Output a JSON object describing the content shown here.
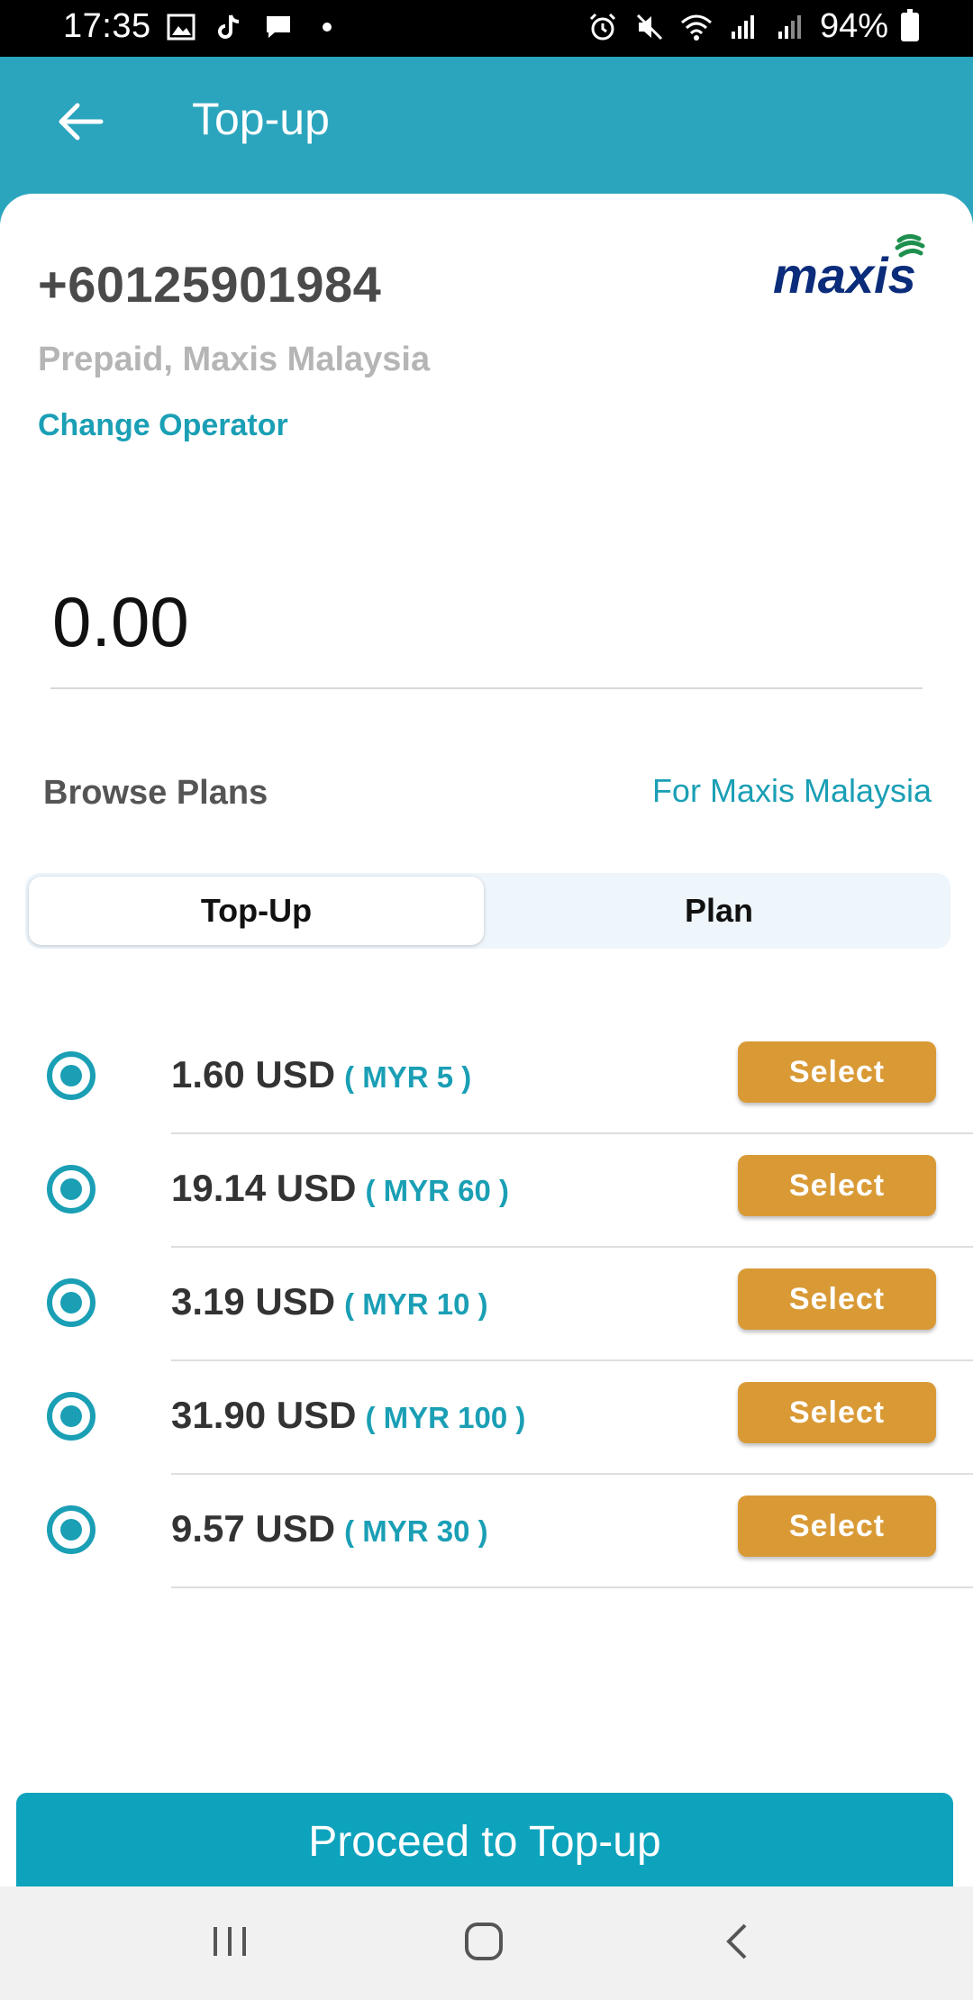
{
  "status_bar": {
    "time": "17:35",
    "battery": "94%",
    "left_icons": [
      "gallery-icon",
      "tiktok-icon",
      "message-icon",
      "dot-icon"
    ],
    "right_icons": [
      "alarm-icon",
      "mute-icon",
      "wifi-icon",
      "signal-icon",
      "signal-icon"
    ]
  },
  "app_bar": {
    "title": "Top-up",
    "back_icon": "arrow-left-icon"
  },
  "account": {
    "phone": "+60125901984",
    "operator_desc": "Prepaid, Maxis Malaysia",
    "change_operator": "Change Operator",
    "logo_text": "maxis"
  },
  "amount": {
    "value": "0.00"
  },
  "plans": {
    "browse_label": "Browse Plans",
    "for_operator": "For Maxis Malaysia",
    "tabs": [
      {
        "label": "Top-Up",
        "active": true
      },
      {
        "label": "Plan",
        "active": false
      }
    ],
    "items": [
      {
        "price": "1.60 USD",
        "local": "( MYR 5 )",
        "button": "Select"
      },
      {
        "price": "19.14 USD",
        "local": "( MYR 60 )",
        "button": "Select"
      },
      {
        "price": "3.19 USD",
        "local": "( MYR 10 )",
        "button": "Select"
      },
      {
        "price": "31.90 USD",
        "local": "( MYR 100 )",
        "button": "Select"
      },
      {
        "price": "9.57 USD",
        "local": "( MYR 30 )",
        "button": "Select"
      }
    ]
  },
  "proceed_label": "Proceed to Top-up",
  "nav": [
    "recents-icon",
    "home-icon",
    "back-icon"
  ],
  "colors": {
    "primary": "#2aa5bd",
    "accent": "#1a9fb5",
    "select": "#d99a36"
  }
}
